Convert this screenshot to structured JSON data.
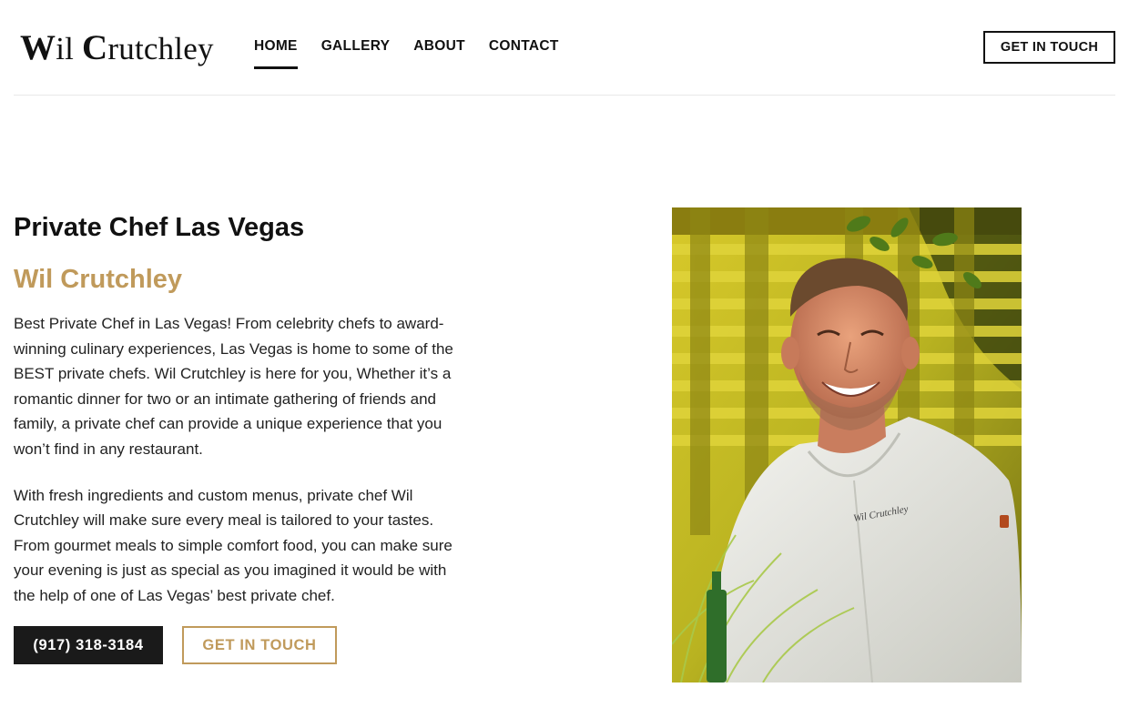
{
  "header": {
    "logo_first_cap": "W",
    "logo_first_rest": "il ",
    "logo_second_cap": "C",
    "logo_second_rest": "rutchley",
    "nav": [
      {
        "label": "HOME",
        "active": true
      },
      {
        "label": "GALLERY",
        "active": false
      },
      {
        "label": "ABOUT",
        "active": false
      },
      {
        "label": "CONTACT",
        "active": false
      }
    ],
    "cta_label": "GET IN TOUCH"
  },
  "main": {
    "title": "Private Chef Las Vegas",
    "subtitle_first_cap": "W",
    "subtitle_first_rest": "il ",
    "subtitle_second_cap": "C",
    "subtitle_second_rest": "rutchley",
    "paragraph_1": "Best Private Chef in Las Vegas!  From celebrity chefs to award-winning culinary experiences, Las Vegas is home to some of the BEST private chefs.  Wil Crutchley is here for you, Whether it’s a romantic dinner for two or an intimate gathering of friends and family, a private chef can provide a unique experience that you won’t find in any restaurant.",
    "paragraph_2": "With fresh ingredients and custom menus, private chef Wil Crutchley will make sure every meal is tailored to your tastes. From gourmet meals to simple comfort food, you can make sure your evening is just as special as you imagined it would be with the help of one of Las Vegas’ best private chef.",
    "phone_button": "(917) 318-3184",
    "contact_button": "GET IN TOUCH",
    "photo": {
      "jacket_text": "Wil Crutchley"
    }
  },
  "colors": {
    "accent_gold": "#c09a5b",
    "dark": "#1a1a1a",
    "photo_background": "#b9b321"
  }
}
